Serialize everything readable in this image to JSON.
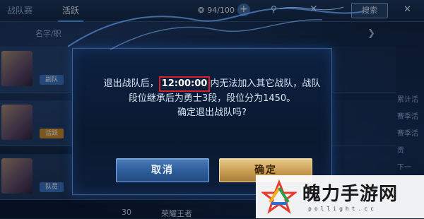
{
  "topbar": {
    "tab_team": "战队赛",
    "tab_active": "活跃",
    "stamina": "94/100",
    "search_button": "搜索"
  },
  "list": {
    "header": "名字/职",
    "rows": [
      {
        "badge": "副队"
      },
      {
        "badge": "活跃"
      },
      {
        "badge": "队员"
      }
    ],
    "side_labels": [
      "累计活",
      "赛季活",
      "赛季活",
      "贡",
      "下一"
    ],
    "bottom_number": "30",
    "bottom_text": "荣耀王者"
  },
  "dialog": {
    "line1_before": "退出战队后，",
    "line1_time": "12:00:00",
    "line1_after": "内无法加入其它战队，战队",
    "line2": "段位继承后为勇士3段，段位分为1450。",
    "line3": "确定退出战队吗?",
    "cancel_label": "取消",
    "confirm_label": "确定"
  },
  "watermark": {
    "title": "魄力手游网",
    "url": "pollight.cc"
  },
  "colors": {
    "highlight_box": "#d9202a",
    "confirm_gold": "#c99c52",
    "cancel_blue": "#2d5c98"
  }
}
